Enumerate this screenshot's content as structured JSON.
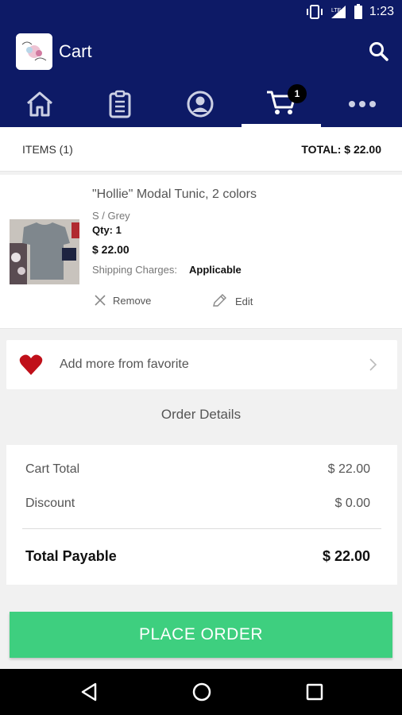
{
  "status_bar": {
    "time": "1:23",
    "network_label": "LTE"
  },
  "app_bar": {
    "title": "Cart"
  },
  "nav": {
    "items": [
      "home-icon",
      "orders-icon",
      "account-icon",
      "cart-icon",
      "more-icon"
    ],
    "cart_badge": "1"
  },
  "summary": {
    "items_label": "ITEMS (1)",
    "total_label": "TOTAL: $ 22.00"
  },
  "product": {
    "name": "\"Hollie\" Modal Tunic, 2 colors",
    "variant": "S / Grey",
    "qty": "Qty: 1",
    "price": "$ 22.00",
    "shipping_label": "Shipping Charges:",
    "shipping_value": "Applicable",
    "remove_label": "Remove",
    "edit_label": "Edit"
  },
  "favorite": {
    "label": "Add more from favorite"
  },
  "order": {
    "heading": "Order Details",
    "rows": [
      {
        "label": "Cart Total",
        "value": "$ 22.00"
      },
      {
        "label": "Discount",
        "value": "$ 0.00"
      }
    ],
    "total_label": "Total Payable",
    "total_value": "$ 22.00"
  },
  "place_order_label": "PLACE ORDER",
  "colors": {
    "primary": "#0d1a66",
    "accent": "#3ecf7f",
    "heart": "#c0101a"
  }
}
